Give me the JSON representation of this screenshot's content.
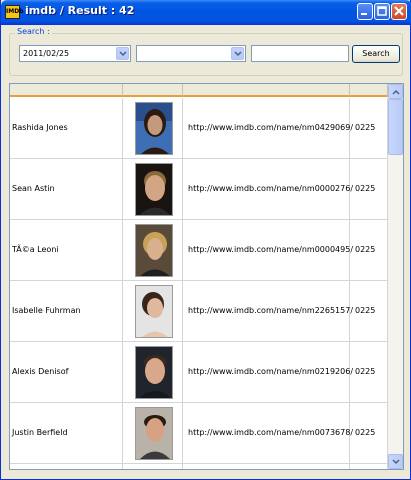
{
  "window": {
    "title": "imdb / Result :  42",
    "app_icon_text": "IMDb"
  },
  "search": {
    "group_label": "Search :",
    "date_value": "2011/02/25",
    "second_combo_value": "",
    "text_value": "",
    "button_label": "Search"
  },
  "grid": {
    "headers": [
      "",
      "",
      "",
      ""
    ],
    "rows": [
      {
        "name": "Rashida Jones",
        "url": "http://www.imdb.com/name/nm0429069/",
        "date": "0225"
      },
      {
        "name": "Sean Astin",
        "url": "http://www.imdb.com/name/nm0000276/",
        "date": "0225"
      },
      {
        "name": "TÃ©a Leoni",
        "url": "http://www.imdb.com/name/nm0000495/",
        "date": "0225"
      },
      {
        "name": "Isabelle Fuhrman",
        "url": "http://www.imdb.com/name/nm2265157/",
        "date": "0225"
      },
      {
        "name": "Alexis Denisof",
        "url": "http://www.imdb.com/name/nm0219206/",
        "date": "0225"
      },
      {
        "name": "Justin Berfield",
        "url": "http://www.imdb.com/name/nm0073678/",
        "date": "0225"
      }
    ]
  },
  "colors": {
    "title_bar": "#0054e3",
    "group_label": "#0046d5",
    "header_accent": "#e2a13e"
  }
}
